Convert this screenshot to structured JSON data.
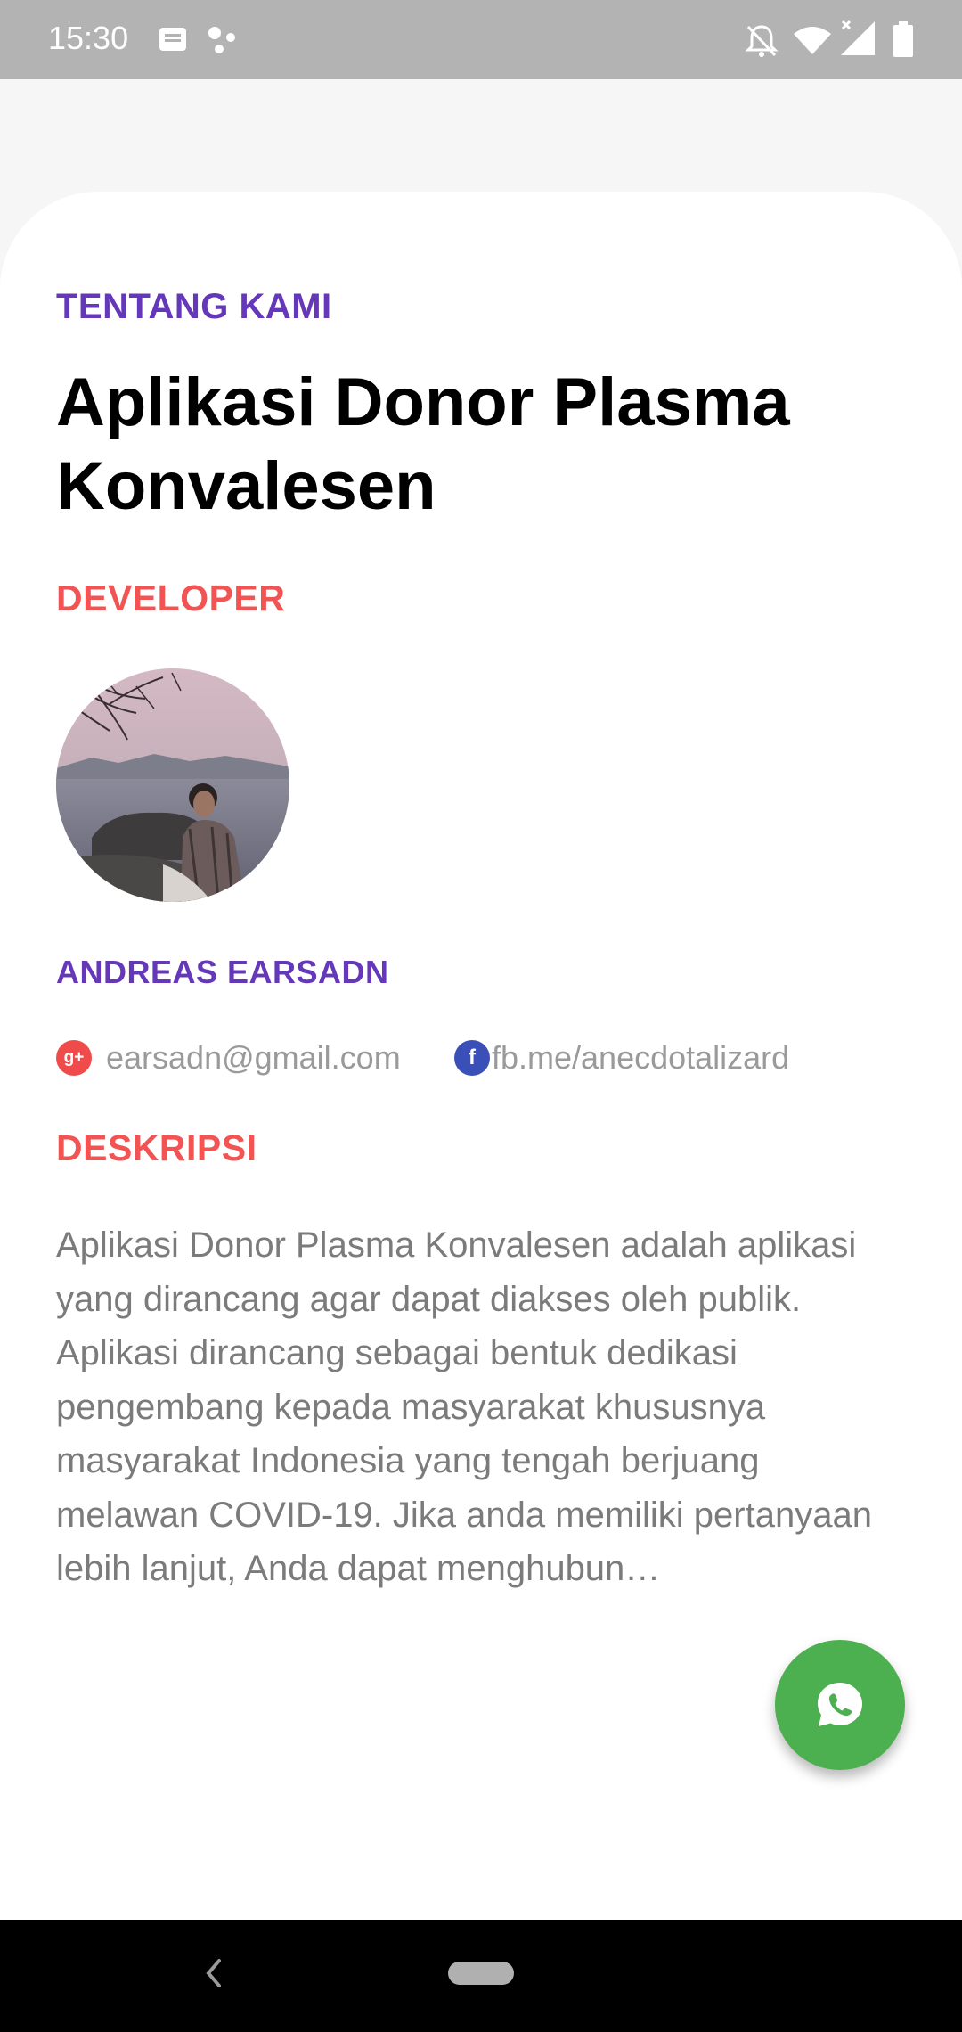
{
  "status_bar": {
    "time": "15:30",
    "icons": [
      "message-icon",
      "dots-icon",
      "mute-icon",
      "wifi-icon",
      "signal-icon",
      "battery-icon"
    ]
  },
  "about": {
    "section_label": "TENTANG KAMI",
    "app_title": "Aplikasi Donor Plasma Konvalesen"
  },
  "developer": {
    "section_label": "DEVELOPER",
    "name": "ANDREAS EARSADN",
    "email": "earsadn@gmail.com",
    "facebook": "fb.me/anecdotalizard"
  },
  "description": {
    "section_label": "DESKRIPSI",
    "text": "Aplikasi Donor Plasma Konvalesen adalah aplikasi yang dirancang agar dapat diakses oleh publik. Aplikasi dirancang sebagai bentuk dedikasi pengembang kepada masyarakat khususnya masyarakat Indonesia yang tengah berjuang melawan COVID-19. Jika anda memiliki pertanyaan lebih lanjut, Anda dapat menghubun…"
  },
  "colors": {
    "accent_purple": "#6438b8",
    "accent_red": "#f25454",
    "whatsapp_green": "#4caf50",
    "google_red": "#f04b4b",
    "facebook_blue": "#3b4fb8"
  },
  "fab": {
    "icon": "whatsapp-icon"
  },
  "nav": {
    "icons": [
      "back-icon",
      "home-pill-icon"
    ]
  }
}
